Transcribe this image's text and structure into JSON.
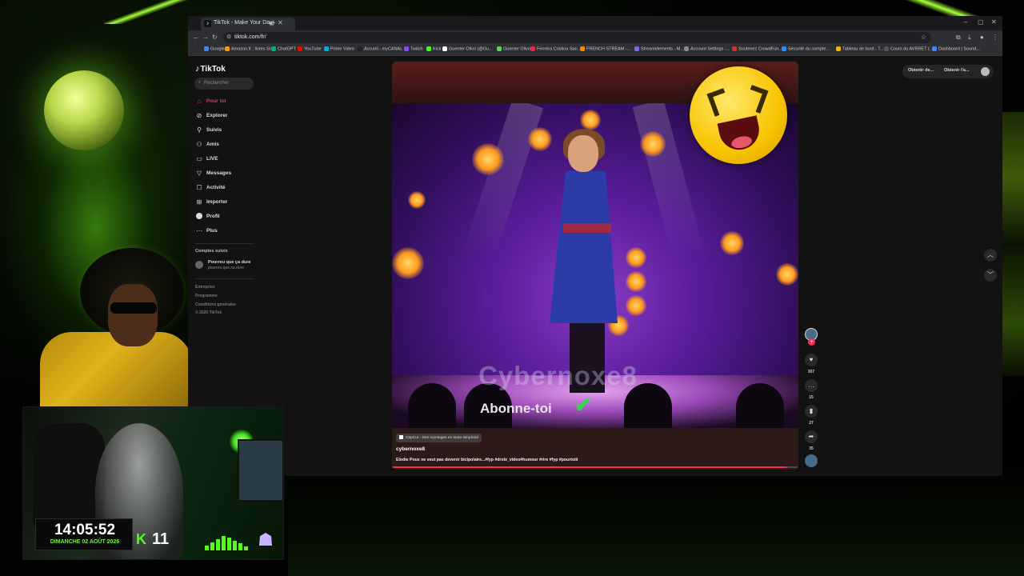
{
  "overlay": {
    "clock_time": "14:05:52",
    "clock_date": "DIMANCHE 02 AOÛT 2026",
    "kick_logo": "K",
    "kick_count": "11"
  },
  "browser": {
    "tab_title": "TikTok - Make Your Day",
    "url": "tiktok.com/fr/",
    "bookmarks": [
      "Google",
      "Amazon.fr : livres SI...",
      "ChatGPT",
      "YouTube",
      "Prime Video",
      "Accueil - myCANAL",
      "Twitch",
      "Kick",
      "Guenter Olivri (@Gu...",
      "Guenter Olivri",
      "Ferreira Cristina San...",
      "FRENCH STREAM -...",
      "Streamelements - M...",
      "Account Settings -...",
      "Soutenez CrowdFun...",
      "Sécurité du compte...",
      "Tableau de bord - T...",
      "Cours du AVRRET (...",
      "Dashboard | Sound..."
    ]
  },
  "sidebar": {
    "logo": "TikTok",
    "search_placeholder": "Rechercher",
    "items": [
      {
        "label": "Pour toi",
        "icon": "home-icon"
      },
      {
        "label": "Explorer",
        "icon": "compass-icon"
      },
      {
        "label": "Suivis",
        "icon": "following-icon"
      },
      {
        "label": "Amis",
        "icon": "friends-icon"
      },
      {
        "label": "LIVE",
        "icon": "live-icon"
      },
      {
        "label": "Messages",
        "icon": "messages-icon"
      },
      {
        "label": "Activité",
        "icon": "activity-icon"
      },
      {
        "label": "Importer",
        "icon": "upload-icon"
      },
      {
        "label": "Profil",
        "icon": "profile-icon"
      },
      {
        "label": "Plus",
        "icon": "more-icon"
      }
    ],
    "followed_title": "Comptes suivis",
    "followed_account": {
      "name": "Pourreu que ça dure",
      "handle": "pourreu.que.ca.dure"
    },
    "footer": [
      "Entreprise",
      "Programme",
      "Conditions générales",
      "© 2026 TikTok"
    ]
  },
  "top_right": {
    "btn1": "Obtenir de...",
    "btn2": "Obtenir l'a..."
  },
  "video": {
    "watermark": "Cybernoxe8",
    "subscribe": "Abonne-toi",
    "capcut": "CapCut - Des montages en toute simplicité",
    "author": "cybernoxe8",
    "description": "Elodie Poux ne veut pas devenir bicipolaire...#fyp #drole_video#humour #rire #fyp #pourtoiii",
    "progress": 0.97
  },
  "actions": {
    "likes": "307",
    "comments": "15",
    "saves": "27",
    "shares": "35"
  },
  "colors": {
    "accent": "#fe2c55",
    "kick": "#53fc18"
  }
}
